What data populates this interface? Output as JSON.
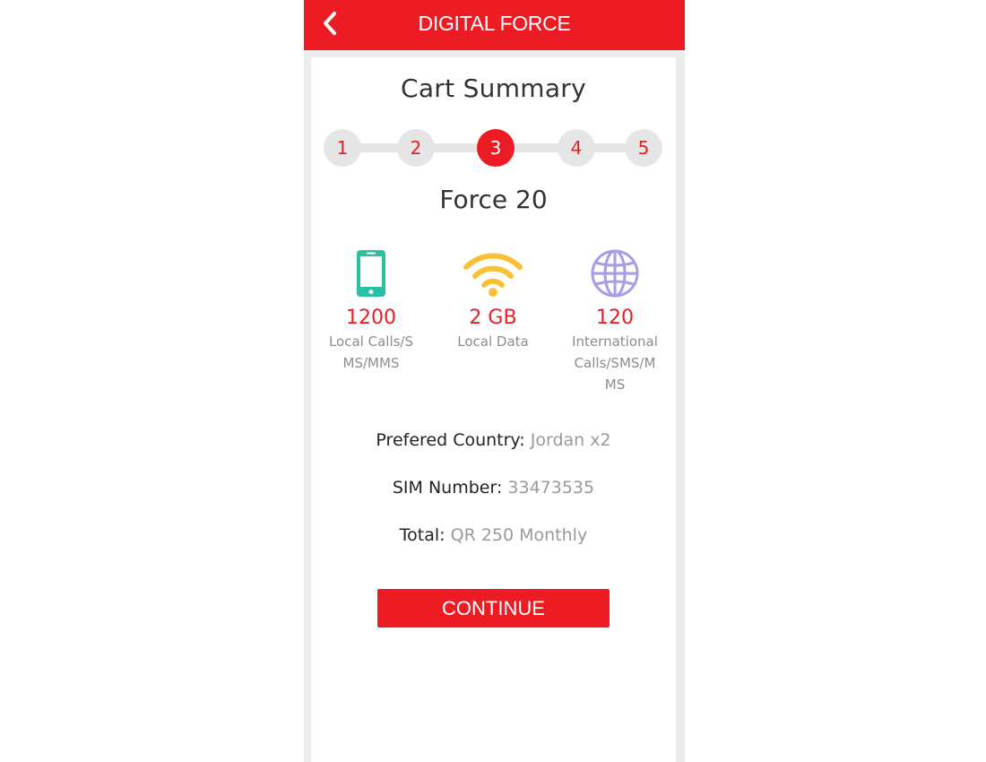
{
  "header": {
    "title": "DIGITAL FORCE",
    "back_icon": "chevron-left-icon"
  },
  "colors": {
    "brand": "#ed1c24",
    "phone_icon": "#2bbfa4",
    "wifi_icon": "#f7c133",
    "globe_icon": "#a99be6"
  },
  "page": {
    "title": "Cart Summary"
  },
  "stepper": {
    "active": 3,
    "steps": [
      "1",
      "2",
      "3",
      "4",
      "5"
    ]
  },
  "plan": {
    "name": "Force 20",
    "features": [
      {
        "icon": "smartphone-icon",
        "value": "1200",
        "desc": "Local Calls/SMS/MMS"
      },
      {
        "icon": "wifi-icon",
        "value": "2 GB",
        "desc": "Local Data"
      },
      {
        "icon": "globe-icon",
        "value": "120",
        "desc": "International Calls/SMS/MMS"
      }
    ]
  },
  "details": {
    "country_label": "Prefered Country:",
    "country_value": "Jordan x2",
    "sim_label": "SIM Number:",
    "sim_value": "33473535",
    "total_label": "Total:",
    "total_value": "QR 250 Monthly"
  },
  "actions": {
    "continue_label": "CONTINUE"
  }
}
